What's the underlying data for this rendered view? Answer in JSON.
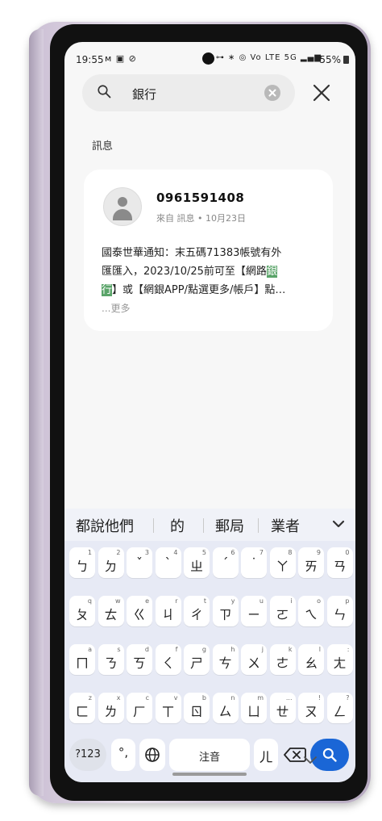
{
  "status": {
    "time": "19:55",
    "left_icons": "ᴍ ▣ ⊘",
    "right_icons": "⊶ ∗ ◎ Vo LTE 5G ▂▄▆",
    "battery": "55%"
  },
  "search": {
    "query": "銀行"
  },
  "section": {
    "label": "訊息"
  },
  "message": {
    "sender": "0961591408",
    "meta": "來自 訊息 • 10月23日",
    "line1": "國泰世華通知：末五碼71383帳號有外",
    "line2_pre": "匯匯入，2023/10/25前可至【網路",
    "hl1": "銀",
    "hl2": "行",
    "line3_post": "】或【網銀APP/點選更多/帳戶】點…",
    "more": "...更多"
  },
  "keyboard": {
    "candidates": [
      "都說他們",
      "的",
      "郵局",
      "業者"
    ],
    "row1": [
      {
        "k": "ㄅ",
        "h": "1"
      },
      {
        "k": "ㄉ",
        "h": "2"
      },
      {
        "k": "ˇ",
        "h": "3"
      },
      {
        "k": "ˋ",
        "h": "4"
      },
      {
        "k": "ㄓ",
        "h": "5"
      },
      {
        "k": "ˊ",
        "h": "6"
      },
      {
        "k": "˙",
        "h": "7"
      },
      {
        "k": "ㄚ",
        "h": "8"
      },
      {
        "k": "ㄞ",
        "h": "9"
      },
      {
        "k": "ㄢ",
        "h": "0"
      }
    ],
    "row2": [
      {
        "k": "ㄆ",
        "h": "q"
      },
      {
        "k": "ㄊ",
        "h": "w"
      },
      {
        "k": "ㄍ",
        "h": "e"
      },
      {
        "k": "ㄐ",
        "h": "r"
      },
      {
        "k": "ㄔ",
        "h": "t"
      },
      {
        "k": "ㄗ",
        "h": "y"
      },
      {
        "k": "ㄧ",
        "h": "u"
      },
      {
        "k": "ㄛ",
        "h": "i"
      },
      {
        "k": "ㄟ",
        "h": "o"
      },
      {
        "k": "ㄣ",
        "h": "p"
      }
    ],
    "row3": [
      {
        "k": "ㄇ",
        "h": "a"
      },
      {
        "k": "ㄋ",
        "h": "s"
      },
      {
        "k": "ㄎ",
        "h": "d"
      },
      {
        "k": "ㄑ",
        "h": "f"
      },
      {
        "k": "ㄕ",
        "h": "g"
      },
      {
        "k": "ㄘ",
        "h": "h"
      },
      {
        "k": "ㄨ",
        "h": "j"
      },
      {
        "k": "ㄜ",
        "h": "k"
      },
      {
        "k": "ㄠ",
        "h": "l"
      },
      {
        "k": "ㄤ",
        "h": ":"
      }
    ],
    "row4": [
      {
        "k": "ㄈ",
        "h": "z"
      },
      {
        "k": "ㄌ",
        "h": "x"
      },
      {
        "k": "ㄏ",
        "h": "c"
      },
      {
        "k": "ㄒ",
        "h": "v"
      },
      {
        "k": "ㄖ",
        "h": "b"
      },
      {
        "k": "ㄙ",
        "h": "n"
      },
      {
        "k": "ㄩ",
        "h": "m"
      },
      {
        "k": "ㄝ",
        "h": "..."
      },
      {
        "k": "ㄡ",
        "h": "!"
      },
      {
        "k": "ㄥ",
        "h": "?"
      }
    ],
    "sym_label": "?123",
    "punct_label": "°,",
    "space_label": "注音",
    "er_label": "ㄦ"
  },
  "colors": {
    "highlight": "#5aa469",
    "accent_search_key": "#1a66d6"
  }
}
